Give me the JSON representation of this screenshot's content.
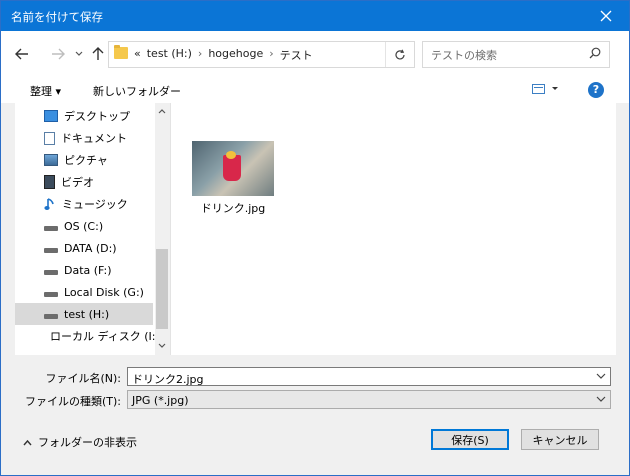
{
  "window": {
    "title": "名前を付けて保存"
  },
  "address": {
    "prefix": "«",
    "crumbs": [
      "test (H:)",
      "hogehoge",
      "テスト"
    ]
  },
  "search": {
    "placeholder": "テストの検索"
  },
  "toolbar": {
    "organize": "整理 ▾",
    "new_folder": "新しいフォルダー"
  },
  "sidebar": {
    "items": [
      {
        "label": "デスクトップ",
        "icon": "desktop-icon"
      },
      {
        "label": "ドキュメント",
        "icon": "document-icon"
      },
      {
        "label": "ピクチャ",
        "icon": "pictures-icon"
      },
      {
        "label": "ビデオ",
        "icon": "video-icon"
      },
      {
        "label": "ミュージック",
        "icon": "music-icon"
      },
      {
        "label": "OS (C:)",
        "icon": "drive-icon"
      },
      {
        "label": "DATA (D:)",
        "icon": "drive-icon"
      },
      {
        "label": "Data (F:)",
        "icon": "drive-icon"
      },
      {
        "label": "Local Disk (G:)",
        "icon": "drive-icon"
      },
      {
        "label": "test (H:)",
        "icon": "drive-icon",
        "selected": true
      },
      {
        "label": "ローカル ディスク (I:)",
        "icon": "drive-icon"
      }
    ]
  },
  "files": [
    {
      "name": "ドリンク.jpg"
    }
  ],
  "form": {
    "filename_label": "ファイル名(N):",
    "filename_value": "ドリンク2.jpg",
    "filetype_label": "ファイルの種類(T):",
    "filetype_value": "JPG (*.jpg)"
  },
  "footer": {
    "hide_folders": "フォルダーの非表示",
    "save": "保存(S)",
    "cancel": "キャンセル"
  },
  "colors": {
    "titlebar": "#0b75d6",
    "accent": "#0078d7"
  }
}
